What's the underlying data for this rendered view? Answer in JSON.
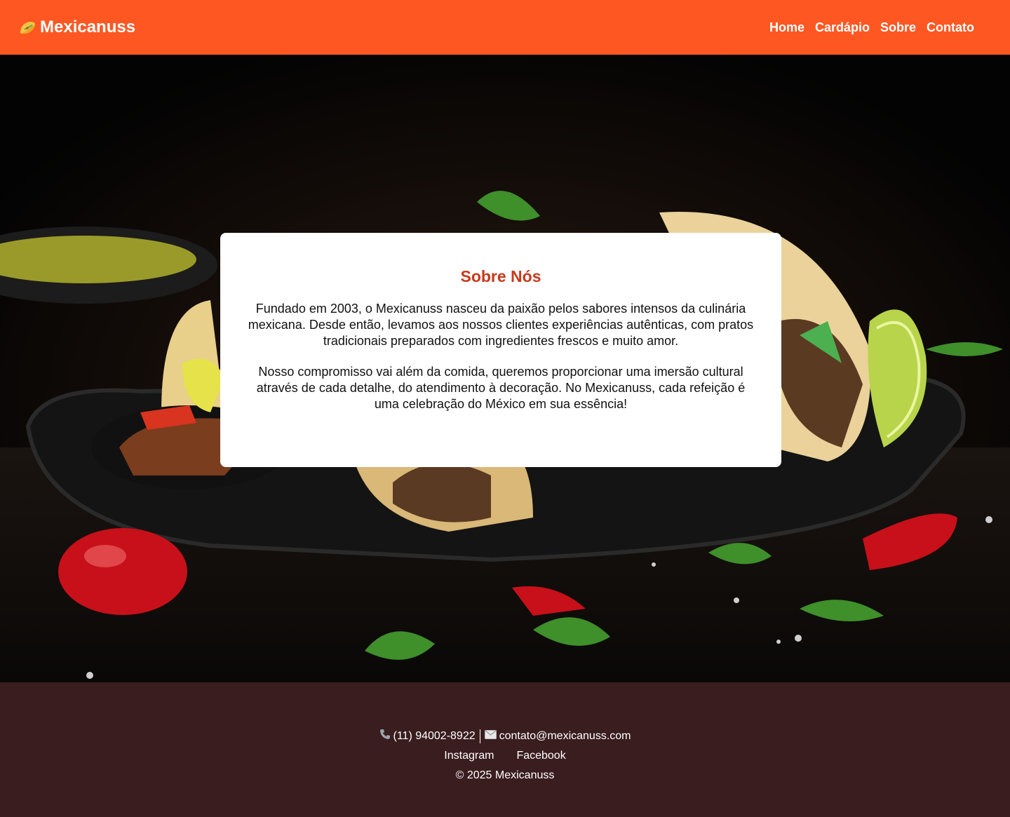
{
  "brand": {
    "name": "Mexicanuss",
    "icon": "taco-icon"
  },
  "nav": {
    "items": [
      "Home",
      "Cardápio",
      "Sobre",
      "Contato"
    ]
  },
  "about": {
    "title": "Sobre Nós",
    "paragraphs": [
      "Fundado em 2003, o Mexicanuss nasceu da paixão pelos sabores intensos da culinária mexicana. Desde então, levamos aos nossos clientes experiências autênticas, com pratos tradicionais preparados com ingredientes frescos e muito amor.",
      "Nosso compromisso vai além da comida, queremos proporcionar uma imersão cultural através de cada detalhe, do atendimento à decoração. No Mexicanuss, cada refeição é uma celebração do México em sua essência!"
    ]
  },
  "footer": {
    "phone_icon": "phone-icon",
    "phone": "(11) 94002-8922",
    "email_icon": "envelope-icon",
    "email": "contato@mexicanuss.com",
    "social": [
      "Instagram",
      "Facebook"
    ],
    "copyright": "© 2025 Mexicanuss"
  },
  "colors": {
    "header": "#ff5722",
    "title": "#c8381a",
    "footer": "#3a1d1f"
  }
}
